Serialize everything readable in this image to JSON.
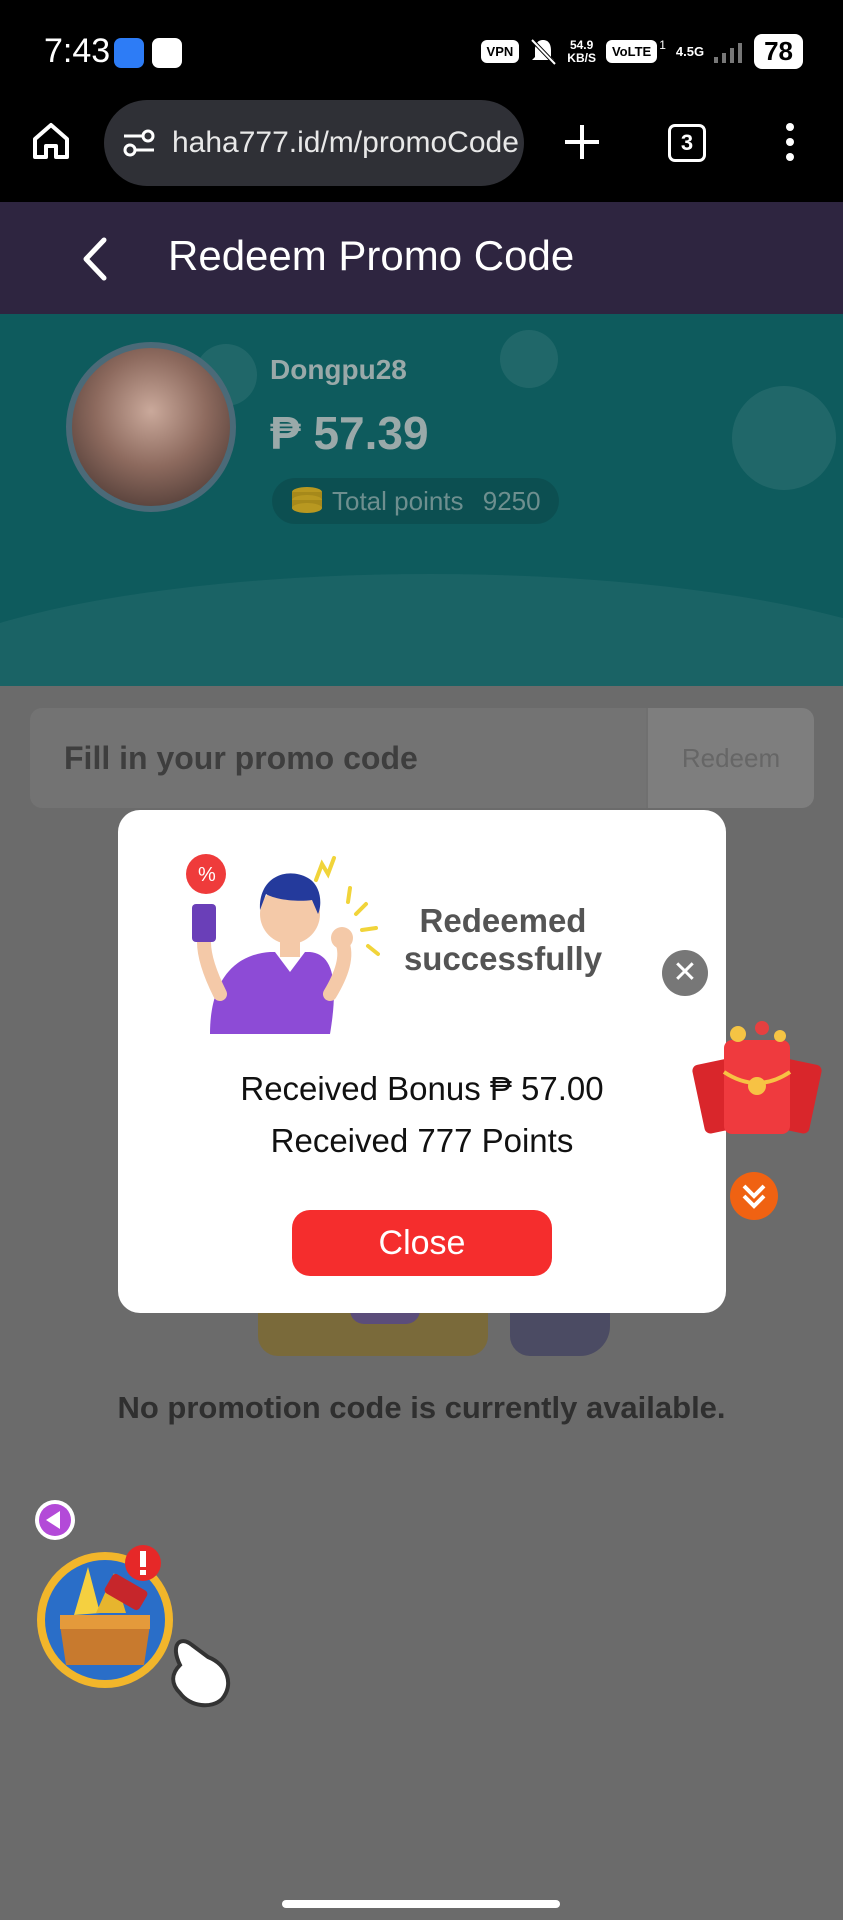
{
  "status_bar": {
    "time": "7:43",
    "vpn": "VPN",
    "net_speed_value": "54.9",
    "net_speed_unit": "KB/S",
    "volte": "VoLTE",
    "volte_sup": "1",
    "network": "4.5G",
    "battery": "78"
  },
  "browser": {
    "url": "haha777.id/m/promoCode",
    "tab_count": "3"
  },
  "header": {
    "title": "Redeem Promo Code"
  },
  "profile": {
    "username": "Dongpu28",
    "balance": "₱ 57.39",
    "points_label": "Total points",
    "points_value": "9250"
  },
  "promo": {
    "placeholder": "Fill in your promo code",
    "redeem_label": "Redeem"
  },
  "empty_message": "No promotion code is currently available.",
  "modal": {
    "title": "Redeemed successfully",
    "bonus_text": "Received Bonus ₱ 57.00",
    "points_text": "Received 777 Points",
    "close_label": "Close"
  },
  "colors": {
    "header_bg": "#2e2540",
    "profile_bg": "#0e5b5d",
    "close_button": "#f52d2d",
    "overlay_page": "#6b6b6b"
  },
  "icons": [
    "home-icon",
    "site-settings-icon",
    "plus-icon",
    "more-icon",
    "back-icon",
    "coin-stack-icon",
    "close-icon",
    "red-packet-icon",
    "chevron-down-double-icon",
    "treasure-chest-icon",
    "hand-pointer-icon",
    "arrow-left-icon"
  ]
}
